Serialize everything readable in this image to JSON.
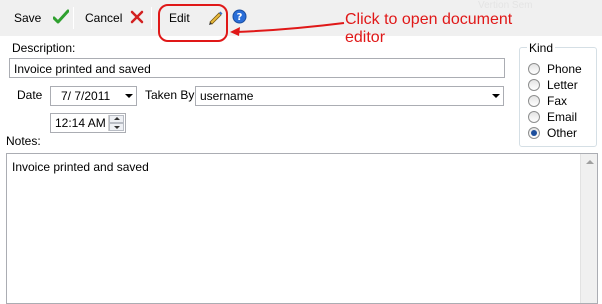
{
  "toolbar": {
    "save_label": "Save",
    "cancel_label": "Cancel",
    "edit_label": "Edit",
    "icons": {
      "save": "checkmark-icon",
      "cancel": "red-x-icon",
      "edit": "pencil-icon",
      "help": "help-icon"
    },
    "watermark": "Vertion Sem"
  },
  "annotation": {
    "text_line1": "Click to open document",
    "text_line2": "editor",
    "color": "#e01818"
  },
  "form": {
    "description_label": "Description:",
    "description_value": "Invoice printed and saved",
    "date_label": "Date",
    "date_value": "7/  7/2011",
    "time_value": "12:14 AM",
    "taken_by_label": "Taken By:",
    "taken_by_value": "username",
    "notes_label": "Notes:",
    "notes_value": "Invoice printed and saved"
  },
  "kind": {
    "title": "Kind",
    "options": [
      "Phone",
      "Letter",
      "Fax",
      "Email",
      "Other"
    ],
    "selected": "Other"
  }
}
